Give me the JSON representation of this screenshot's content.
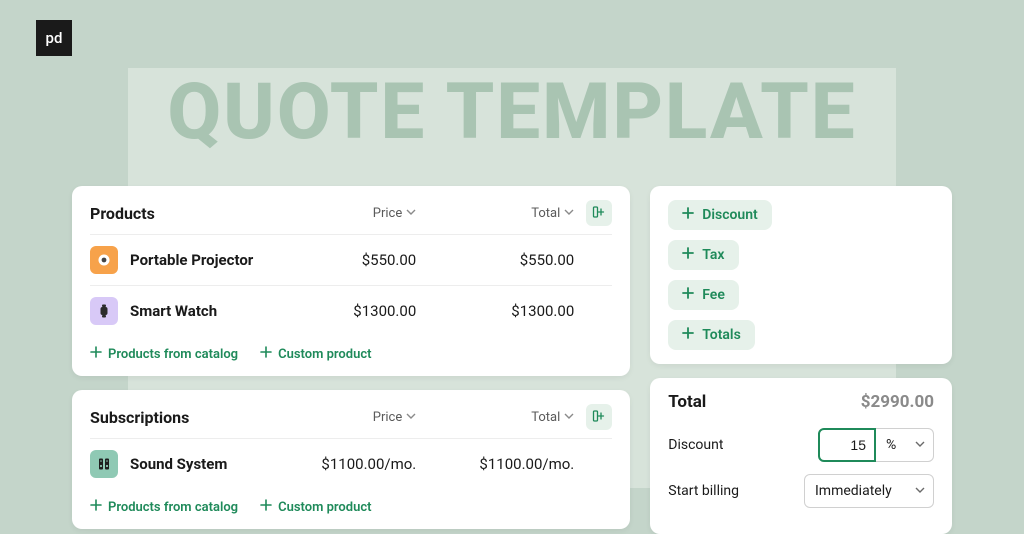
{
  "brand": {
    "logo_text": "pd"
  },
  "banner": {
    "title": "QUOTE TEMPLATE"
  },
  "products_card": {
    "title": "Products",
    "columns": {
      "price": "Price",
      "total": "Total"
    },
    "rows": [
      {
        "name": "Portable Projector",
        "price": "$550.00",
        "total": "$550.00",
        "thumb_icon": "projector-icon",
        "thumb_class": "thumb-orange"
      },
      {
        "name": "Smart Watch",
        "price": "$1300.00",
        "total": "$1300.00",
        "thumb_icon": "watch-icon",
        "thumb_class": "thumb-violet"
      }
    ],
    "actions": {
      "from_catalog": "Products from catalog",
      "custom": "Custom product"
    }
  },
  "subscriptions_card": {
    "title": "Subscriptions",
    "columns": {
      "price": "Price",
      "total": "Total"
    },
    "rows": [
      {
        "name": "Sound System",
        "price": "$1100.00/mo.",
        "total": "$1100.00/mo.",
        "thumb_icon": "speaker-icon",
        "thumb_class": "thumb-teal"
      }
    ],
    "actions": {
      "from_catalog": "Products from catalog",
      "custom": "Custom product"
    }
  },
  "pills": {
    "discount": "Discount",
    "tax": "Tax",
    "fee": "Fee",
    "totals": "Totals"
  },
  "summary": {
    "total_label": "Total",
    "total_value": "$2990.00",
    "discount_label": "Discount",
    "discount_value": "15",
    "discount_unit": "%",
    "start_billing_label": "Start billing",
    "start_billing_value": "Immediately"
  }
}
